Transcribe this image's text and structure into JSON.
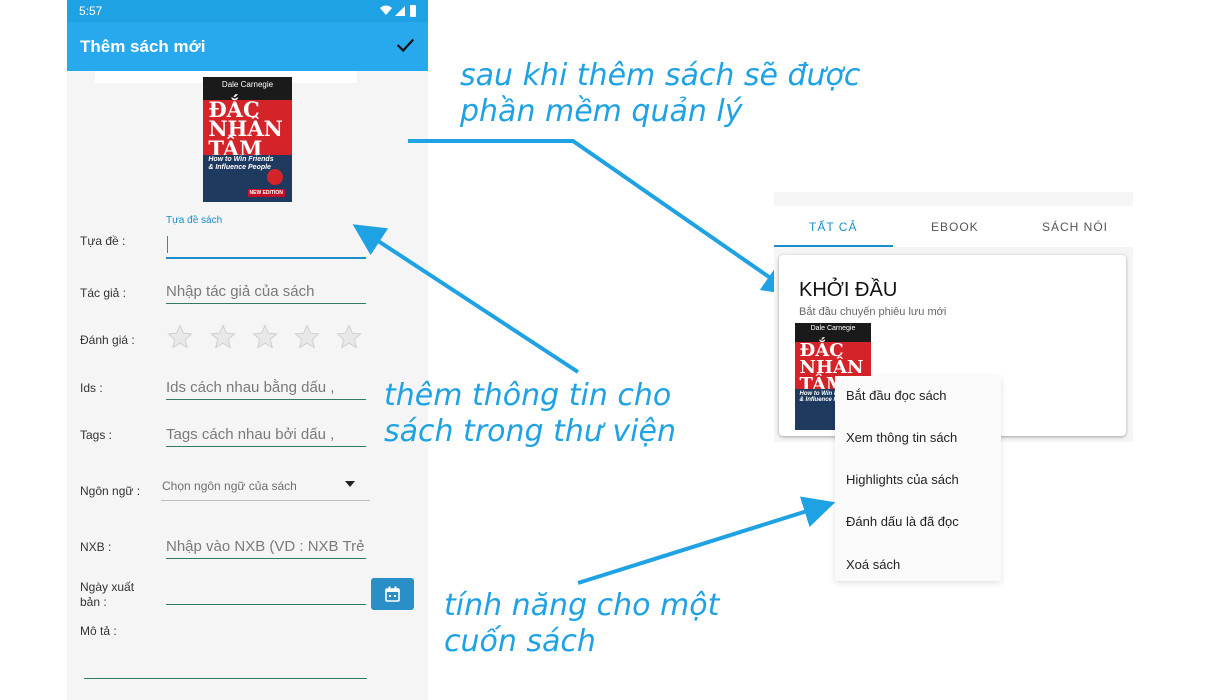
{
  "status_bar": {
    "time": "5:57"
  },
  "app_bar": {
    "title": "Thêm sách mới"
  },
  "book_cover": {
    "author": "Dale Carnegie",
    "title_line1": "ĐẮC",
    "title_line2": "NHÂN",
    "title_line3": "TÂM",
    "english_title_line1": "How to Win Friends",
    "english_title_line2": "& Influence People",
    "edition_badge": "NEW EDITION"
  },
  "form": {
    "title": {
      "label": "Tựa đề :",
      "floating_label": "Tựa đề sách",
      "value": ""
    },
    "author": {
      "label": "Tác giả :",
      "placeholder": "Nhập tác giả của sách"
    },
    "rating": {
      "label": "Đánh giá :",
      "stars": 5,
      "value": 0
    },
    "ids": {
      "label": "Ids :",
      "placeholder": "Ids cách nhau bằng dấu ,"
    },
    "tags": {
      "label": "Tags :",
      "placeholder": "Tags cách nhau bởi dấu ,"
    },
    "language": {
      "label": "Ngôn ngữ :",
      "placeholder": "Chọn ngôn ngữ của sách"
    },
    "publisher": {
      "label": "NXB :",
      "placeholder": "Nhập vào NXB (VD : NXB Trẻ"
    },
    "publish_date": {
      "label_line1": "Ngày xuất",
      "label_line2": "bản :",
      "value": ""
    },
    "description": {
      "label": "Mô tả :",
      "value": ""
    }
  },
  "annotations": {
    "top_line1": "sau khi thêm sách sẽ được",
    "top_line2": "phần mềm quản lý",
    "middle_line1": "thêm thông tin cho",
    "middle_line2": "sách trong thư viện",
    "bottom_line1": "tính năng cho một",
    "bottom_line2": "cuốn sách"
  },
  "library": {
    "tabs": [
      {
        "label": "TẤT CẢ",
        "active": true
      },
      {
        "label": "EBOOK",
        "active": false
      },
      {
        "label": "SÁCH NÓI",
        "active": false
      }
    ],
    "card": {
      "title": "KHỞI ĐẦU",
      "subtitle": "Bắt đầu chuyến phiêu lưu mới"
    },
    "menu": [
      "Bắt đầu đọc sách",
      "Xem thông tin sách",
      "Highlights của sách",
      "Đánh dấu là đã đọc",
      "Xoá sách"
    ]
  },
  "colors": {
    "app_bar": "#29a9ed",
    "status_bar": "#1fa2e4",
    "accent": "#1fa2e4",
    "field_underline": "#2e7d5b",
    "date_button": "#2b8fc7"
  }
}
